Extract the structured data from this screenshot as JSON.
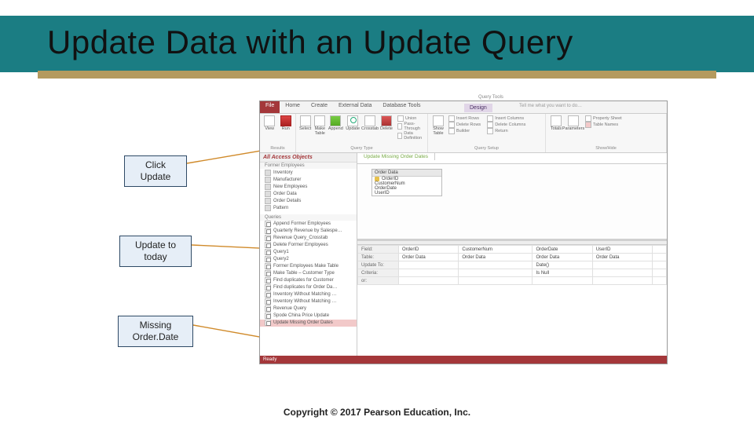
{
  "slide": {
    "title": "Update Data with an Update Query",
    "copyright": "Copyright © 2017 Pearson Education, Inc."
  },
  "callouts": {
    "c1": {
      "line1": "Click",
      "line2": "Update"
    },
    "c2": {
      "line1": "Update to",
      "line2": "today"
    },
    "c3": {
      "line1": "Missing",
      "line2": "Order.Date"
    }
  },
  "access": {
    "tabs": {
      "file": "File",
      "home": "Home",
      "create": "Create",
      "external": "External Data",
      "dbtools": "Database Tools",
      "design": "Design"
    },
    "query_tools": "Query Tools",
    "tellme": "Tell me what you want to do…",
    "ribbon": {
      "view": "View",
      "run": "Run",
      "select": "Select",
      "make": "Make Table",
      "append": "Append",
      "update": "Update",
      "crosstab": "Crosstab",
      "delete": "Delete",
      "union": "Union",
      "passthrough": "Pass-Through",
      "datadef": "Data Definition",
      "showtable": "Show Table",
      "insrows": "Insert Rows",
      "delrows": "Delete Rows",
      "builder": "Builder",
      "inscols": "Insert Columns",
      "delcols": "Delete Columns",
      "return": "Return",
      "totals": "Totals",
      "params": "Parameters",
      "propsheet": "Property Sheet",
      "tblnames": "Table Names",
      "grp_results": "Results",
      "grp_qtype": "Query Type",
      "grp_setup": "Query Setup",
      "grp_showhide": "Show/Hide"
    },
    "nav": {
      "header": "All Access Objects",
      "sub": "Former Employees",
      "items": [
        "Inventory",
        "Manufacturer",
        "New Employees",
        "Order Data",
        "Order Details",
        "Pattern"
      ],
      "queries_hdr": "Queries",
      "queries": [
        "Append Former Employees",
        "Quarterly Revenue by Salespe…",
        "Revenue Query_Crosstab",
        "Delete Former Employees",
        "Query1",
        "Query2",
        "Former Employees Make Table",
        "Make Table – Customer Type",
        "Find duplicates for Customer",
        "Find duplicates for Order Da…",
        "Inventory Without Matching …",
        "Inventory Without Matching …",
        "Revenue Query",
        "Spode China Price Update",
        "Update Missing Order Dates"
      ]
    },
    "doc_tab": "Update Missing Order Dates",
    "fieldlist": {
      "title": "Order Data",
      "fields": [
        "OrderID",
        "CustomerNum",
        "OrderDate",
        "UserID"
      ]
    },
    "grid": {
      "rows": [
        "Field:",
        "Table:",
        "Update To:",
        "Criteria:",
        "or:"
      ],
      "cols": [
        {
          "field": "OrderID",
          "table": "Order Data",
          "update": "",
          "criteria": ""
        },
        {
          "field": "CustomerNum",
          "table": "Order Data",
          "update": "",
          "criteria": ""
        },
        {
          "field": "OrderDate",
          "table": "Order Data",
          "update": "Date()",
          "criteria": "Is Null"
        },
        {
          "field": "UserID",
          "table": "Order Data",
          "update": "",
          "criteria": ""
        }
      ]
    },
    "status": "Ready"
  }
}
